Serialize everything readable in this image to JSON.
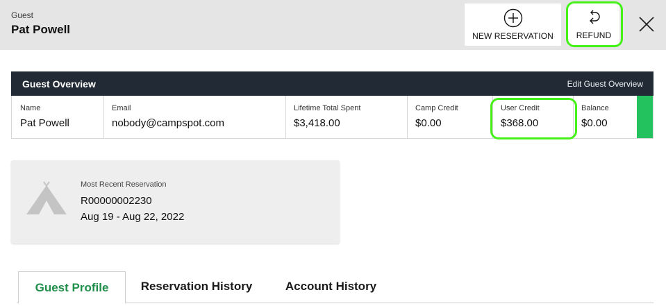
{
  "header": {
    "guest_label": "Guest",
    "guest_name": "Pat Powell",
    "new_reservation_label": "NEW RESERVATION",
    "refund_label": "REFUND"
  },
  "overview": {
    "title": "Guest Overview",
    "edit_label": "Edit Guest Overview",
    "fields": {
      "name": {
        "label": "Name",
        "value": "Pat Powell"
      },
      "email": {
        "label": "Email",
        "value": "nobody@campspot.com"
      },
      "lifetime": {
        "label": "Lifetime Total Spent",
        "value": "$3,418.00"
      },
      "camp_credit": {
        "label": "Camp Credit",
        "value": "$0.00"
      },
      "user_credit": {
        "label": "User Credit",
        "value": "$368.00"
      },
      "balance": {
        "label": "Balance",
        "value": "$0.00"
      }
    },
    "status_color": "#24c25e"
  },
  "recent_reservation": {
    "label": "Most Recent Reservation",
    "number": "R00000002230",
    "dates": "Aug 19 - Aug 22, 2022"
  },
  "tabs": [
    {
      "label": "Guest Profile",
      "active": true
    },
    {
      "label": "Reservation History",
      "active": false
    },
    {
      "label": "Account History",
      "active": false
    }
  ],
  "colors": {
    "highlight": "#45f118",
    "header_bg": "#e5e5e5",
    "overview_bar": "#222b35",
    "active_tab": "#1f8f4a"
  },
  "icons": {
    "new_reservation": "plus-circle-icon",
    "refund": "refund-arrow-icon",
    "close": "close-icon",
    "reservation": "tent-icon"
  }
}
